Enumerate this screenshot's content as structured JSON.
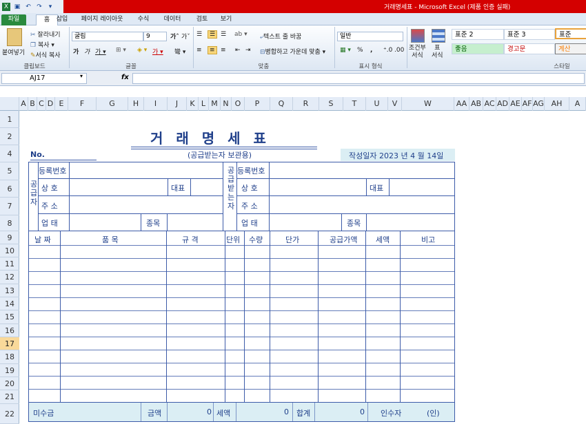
{
  "window": {
    "title": "거래명세표 - Microsoft Excel (제품 인증 실패)"
  },
  "tabs": [
    "파일",
    "홈",
    "삽입",
    "페이지 레이아웃",
    "수식",
    "데이터",
    "검토",
    "보기"
  ],
  "clipboard": {
    "paste": "붙여넣기",
    "cut": "잘라내기",
    "copy": "복사",
    "format_painter": "서식 복사",
    "label": "클립보드"
  },
  "font": {
    "name": "굴림",
    "size": "9",
    "label": "글꼴"
  },
  "alignment": {
    "wrap": "텍스트 줄 바꿈",
    "merge": "병합하고 가운데 맞춤",
    "label": "맞춤"
  },
  "number": {
    "format": "일반",
    "label": "표시 형식"
  },
  "styles": {
    "cond_format": "조건부\n서식",
    "table_format": "표\n서식",
    "s1": "표준 2",
    "s2": "표준 3",
    "s3": "표준",
    "s4": "좋음",
    "s5": "경고문",
    "s6": "계산",
    "label": "스타일"
  },
  "formula_bar": {
    "cell_ref": "AJ17",
    "fx": "fx",
    "value": ""
  },
  "columns": [
    "A",
    "B",
    "C",
    "D",
    "E",
    "F",
    "G",
    "H",
    "I",
    "J",
    "K",
    "L",
    "M",
    "N",
    "O",
    "P",
    "Q",
    "R",
    "S",
    "T",
    "U",
    "V",
    "W",
    "AA",
    "AB",
    "AC",
    "AD",
    "AE",
    "AF",
    "AG",
    "AH",
    "A"
  ],
  "rows": [
    "1",
    "2",
    "4",
    "5",
    "6",
    "7",
    "8",
    "9",
    "10",
    "11",
    "12",
    "13",
    "14",
    "15",
    "16",
    "17",
    "18",
    "19",
    "20",
    "21",
    "22"
  ],
  "selected_row": "17",
  "form": {
    "title": "거 래 명 세 표",
    "no_label": "No.",
    "subtitle": "(공급받는자 보관용)",
    "date": "작성일자   2023 년 4 월 14일",
    "supplier_side": "공급자",
    "receiver_side": "공급받는자",
    "reg_no": "등록번호",
    "company": "상    호",
    "rep": "대표",
    "address": "주    소",
    "business": "업    태",
    "item_type": "종목",
    "headers": [
      "날 짜",
      "품          목",
      "규    격",
      "단위",
      "수량",
      "단가",
      "공급가액",
      "세액",
      "비고"
    ],
    "footer": {
      "unpaid": "미수금",
      "amount": "금액",
      "amount_val": "0",
      "tax": "세액",
      "tax_val": "0",
      "total": "합계",
      "total_val": "0",
      "receiver": "인수자",
      "seal": "(인)"
    }
  }
}
